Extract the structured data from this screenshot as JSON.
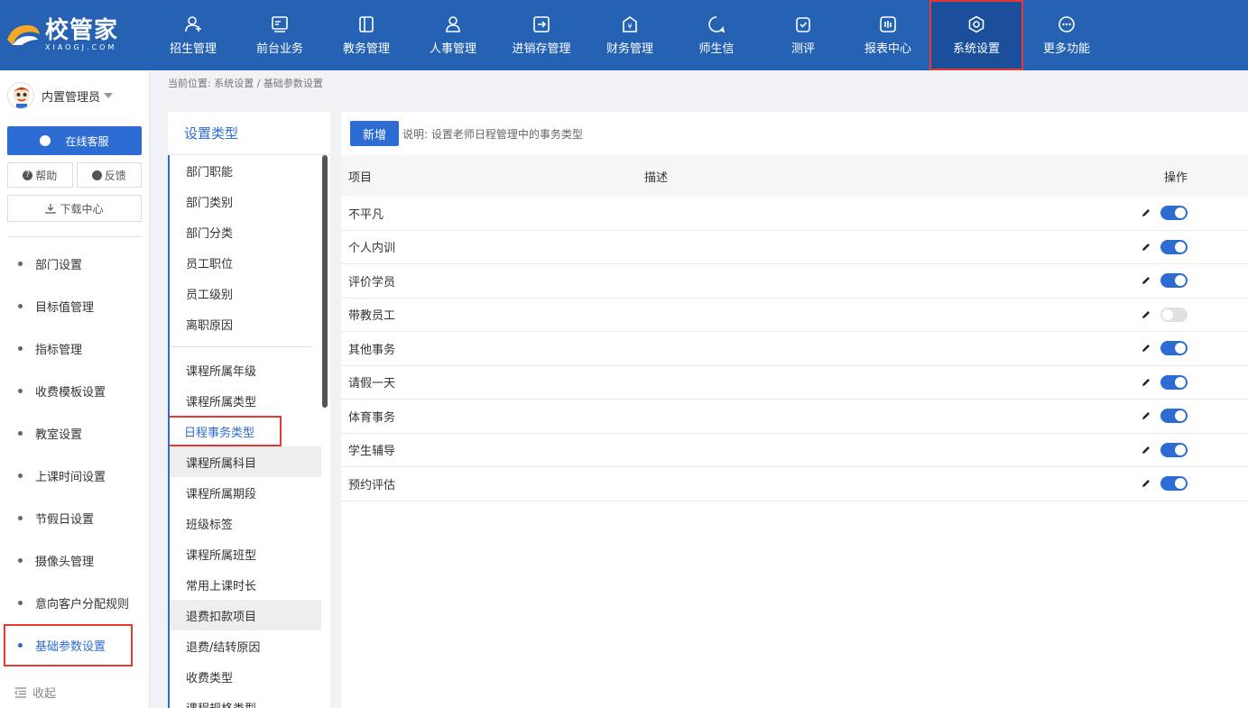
{
  "brand": {
    "name": "校管家",
    "subtitle": "XIAOGJ.COM"
  },
  "nav": [
    {
      "label": "招生管理",
      "icon": "person-add-icon"
    },
    {
      "label": "前台业务",
      "icon": "frontdesk-icon"
    },
    {
      "label": "教务管理",
      "icon": "book-icon"
    },
    {
      "label": "人事管理",
      "icon": "person-icon"
    },
    {
      "label": "进销存管理",
      "icon": "inventory-icon"
    },
    {
      "label": "财务管理",
      "icon": "money-bag-icon"
    },
    {
      "label": "师生信",
      "icon": "chat-bubble-icon"
    },
    {
      "label": "测评",
      "icon": "clipboard-check-icon"
    },
    {
      "label": "报表中心",
      "icon": "report-icon"
    },
    {
      "label": "系统设置",
      "icon": "settings-icon",
      "active": true
    },
    {
      "label": "更多功能",
      "icon": "more-icon"
    }
  ],
  "user": {
    "name": "内置管理员"
  },
  "sidebar": {
    "online_service": "在线客服",
    "help": "帮助",
    "feedback": "反馈",
    "download": "下载中心",
    "items": [
      "部门设置",
      "目标值管理",
      "指标管理",
      "收费模板设置",
      "教室设置",
      "上课时间设置",
      "节假日设置",
      "摄像头管理",
      "意向客户分配规则",
      "基础参数设置"
    ],
    "active_item": "基础参数设置",
    "collapse": "收起"
  },
  "breadcrumb": "当前位置: 系统设置 / 基础参数设置",
  "type_panel": {
    "title": "设置类型",
    "group1": [
      "部门职能",
      "部门类别",
      "部门分类",
      "员工职位",
      "员工级别",
      "离职原因"
    ],
    "group2": [
      "课程所属年级",
      "课程所属类型",
      "日程事务类型",
      "课程所属科目",
      "课程所属期段",
      "班级标签",
      "课程所属班型",
      "常用上课时长",
      "退费扣款项目",
      "退费/结转原因",
      "收费类型",
      "课程规格类型"
    ],
    "active": "日程事务类型"
  },
  "main": {
    "add_label": "新增",
    "note": "说明: 设置老师日程管理中的事务类型",
    "columns": {
      "item": "项目",
      "desc": "描述",
      "op": "操作"
    },
    "rows": [
      {
        "item": "不平凡",
        "desc": "",
        "enabled": true
      },
      {
        "item": "个人内训",
        "desc": "",
        "enabled": true
      },
      {
        "item": "评价学员",
        "desc": "",
        "enabled": true
      },
      {
        "item": "带教员工",
        "desc": "",
        "enabled": false
      },
      {
        "item": "其他事务",
        "desc": "",
        "enabled": true
      },
      {
        "item": "请假一天",
        "desc": "",
        "enabled": true
      },
      {
        "item": "体育事务",
        "desc": "",
        "enabled": true
      },
      {
        "item": "学生辅导",
        "desc": "",
        "enabled": true
      },
      {
        "item": "预约评估",
        "desc": "",
        "enabled": true
      }
    ]
  },
  "colors": {
    "nav_bg": "#2562b4",
    "accent": "#2d6cd3",
    "highlight_border": "#e53935"
  }
}
